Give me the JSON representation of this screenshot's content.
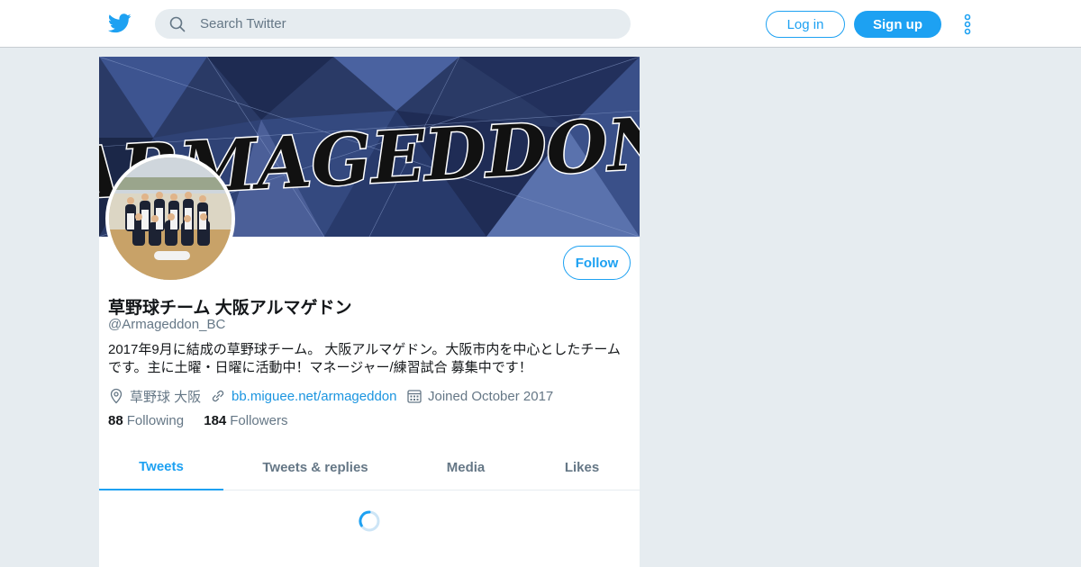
{
  "header": {
    "search_placeholder": "Search Twitter",
    "login_label": "Log in",
    "signup_label": "Sign up"
  },
  "profile": {
    "display_name": "草野球チーム 大阪アルマゲドン",
    "handle": "@Armageddon_BC",
    "bio": "2017年9月に結成の草野球チーム。 大阪アルマゲドン。大阪市内を中心としたチームです。主に土曜・日曜に活動中！マネージャー/練習試合 募集中です！",
    "location": "草野球 大阪",
    "website": "bb.miguee.net/armageddon",
    "joined": "Joined October 2017",
    "following_count": "88",
    "following_label": "Following",
    "followers_count": "184",
    "followers_label": "Followers",
    "follow_label": "Follow",
    "banner_text": "ARMAGEDDON"
  },
  "tabs": [
    {
      "label": "Tweets",
      "active": true
    },
    {
      "label": "Tweets & replies",
      "active": false
    },
    {
      "label": "Media",
      "active": false
    },
    {
      "label": "Likes",
      "active": false
    }
  ],
  "colors": {
    "accent": "#1da1f2",
    "link": "#1b95e0",
    "background": "#e6ecf0",
    "secondary_text": "#657786"
  },
  "icons": [
    "twitter-bird-icon",
    "search-icon",
    "more-vertical-icon",
    "location-icon",
    "link-icon",
    "calendar-icon",
    "loading-spinner-icon"
  ]
}
